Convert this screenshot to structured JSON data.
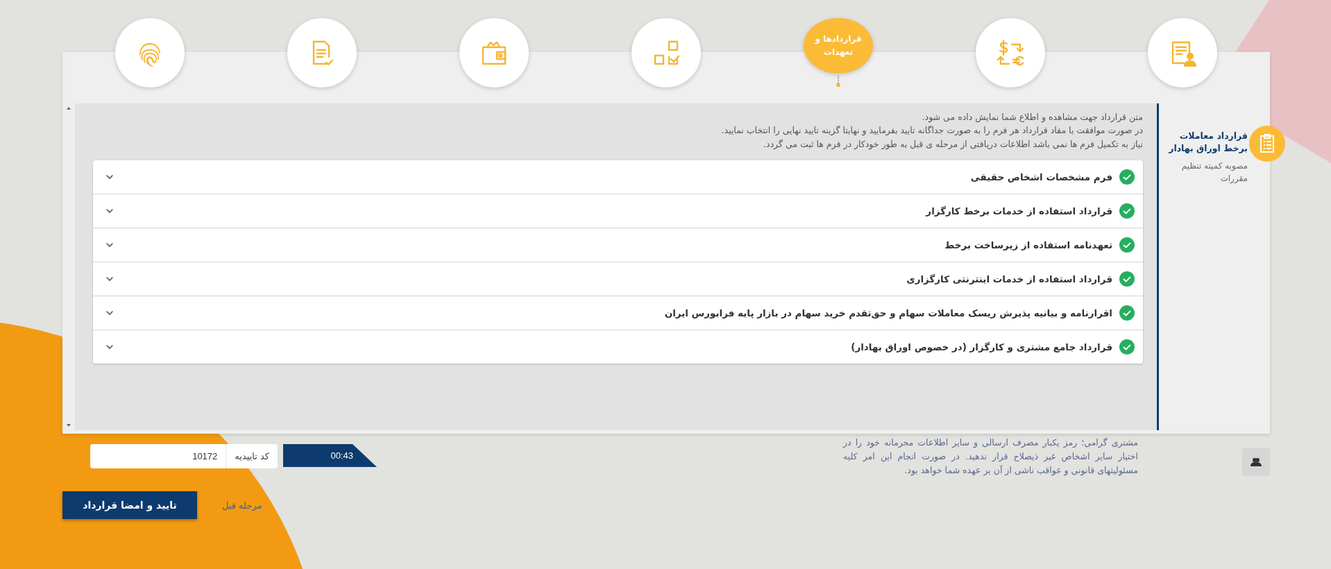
{
  "steps": [
    {
      "selected": false
    },
    {
      "selected": false
    },
    {
      "label": "قراردادها و تعهدات",
      "selected": true
    },
    {
      "selected": false
    },
    {
      "selected": false
    },
    {
      "selected": false
    },
    {
      "selected": false
    }
  ],
  "sidebar": {
    "title": "قرارداد معاملات برخط اوراق بهادار",
    "subtitle": "مصوبه کمیته تنظیم مقررات"
  },
  "intro": [
    "متن قرارداد جهت مشاهده و اطلاع شما نمایش داده می شود.",
    "در صورت موافقت با مفاد قرارداد هر فرم را به صورت جداگانه تایید بفرمایید و نهایتا گزینه تایید نهایی را انتخاب نمایید.",
    "نیاز به تکمیل فرم ها نمی باشد اطلاعات دریافتی از مرحله ی قبل به طور خودکار در فرم ها ثبت می گردد."
  ],
  "contracts": [
    {
      "title": "فرم مشخصات اشخاص حقیقی",
      "checked": true
    },
    {
      "title": "قرارداد استفاده از خدمات برخط کارگزار",
      "checked": true
    },
    {
      "title": "تعهدنامه استفاده از زیرساخت برخط",
      "checked": true
    },
    {
      "title": "قرارداد استفاده از خدمات اینترنتی کارگزاری",
      "checked": true
    },
    {
      "title": "اقرارنامه و بیانیه پذیرش ریسک معاملات سهام و حق‌تقدم خرید سهام در بازار پایه فرابورس ایران",
      "checked": true
    },
    {
      "title": "قرارداد جامع مشتری و کارگزار (در خصوص اوراق بهادار)",
      "checked": true
    }
  ],
  "otp": {
    "timer": "00:43",
    "label": "کد تاییدیه",
    "value": "10172"
  },
  "notice": "مشتری گرامی؛ رمز یکبار مصرف ارسالی و سایر اطلاعات محرمانه خود را در اختیار سایر اشخاص غیر ذیصلاح قرار ندهید. در صورت انجام این امر کلیه مسئولیتهای قانونی و عواقب ناشی از آن بر عهده شما خواهد بود.",
  "buttons": {
    "confirm": "تایید و امضا قرارداد",
    "back": "مرحله قبل"
  }
}
